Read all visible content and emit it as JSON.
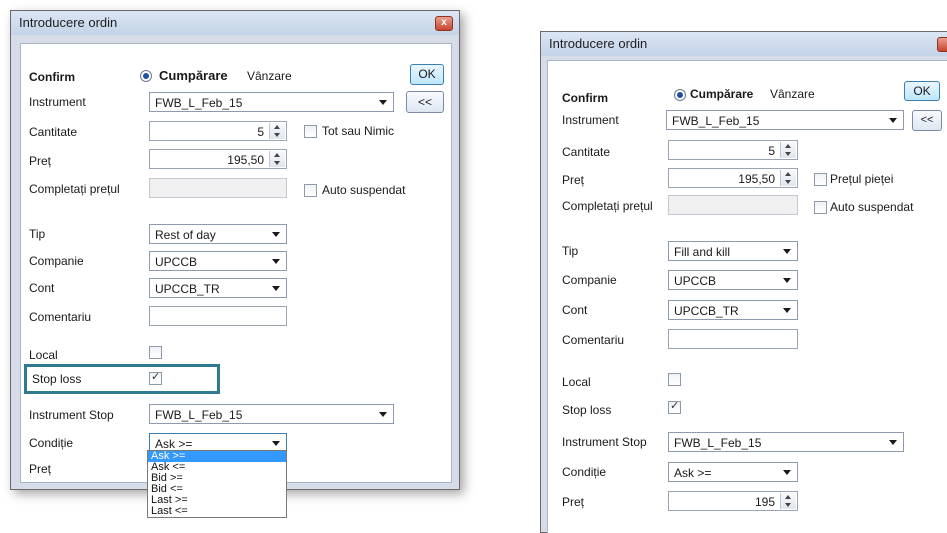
{
  "left": {
    "title": "Introducere ordin",
    "close": "x",
    "confirm_label": "Confirm",
    "buy_label": "Cumpărare",
    "sell_label": "Vânzare",
    "ok_label": "OK",
    "instrument_label": "Instrument",
    "instrument_value": "FWB_L_Feb_15",
    "expand_label": "<<",
    "quantity_label": "Cantitate",
    "quantity_value": "5",
    "all_or_nothing_label": "Tot sau Nimic",
    "price_label": "Preț",
    "price_value": "195,50",
    "fill_price_label": "Completați prețul",
    "auto_suspend_label": "Auto suspendat",
    "type_label": "Tip",
    "type_value": "Rest of day",
    "company_label": "Companie",
    "company_value": "UPCCB",
    "account_label": "Cont",
    "account_value": "UPCCB_TR",
    "comment_label": "Comentariu",
    "local_label": "Local",
    "stoploss_label": "Stop loss",
    "stoploss_checked": true,
    "stop_instrument_label": "Instrument Stop",
    "stop_instrument_value": "FWB_L_Feb_15",
    "condition_label": "Condiție",
    "condition_value": "Ask >=",
    "stop_price_label": "Preț",
    "condition_options": [
      "Ask >=",
      "Ask <=",
      "Bid >=",
      "Bid <=",
      "Last >=",
      "Last <="
    ]
  },
  "right": {
    "title": "Introducere ordin",
    "confirm_label": "Confirm",
    "buy_label": "Cumpărare",
    "sell_label": "Vânzare",
    "ok_label": "OK",
    "instrument_label": "Instrument",
    "instrument_value": "FWB_L_Feb_15",
    "expand_label": "<<",
    "quantity_label": "Cantitate",
    "quantity_value": "5",
    "price_label": "Preț",
    "price_value": "195,50",
    "market_price_label": "Prețul pieței",
    "fill_price_label": "Completați prețul",
    "auto_suspend_label": "Auto suspendat",
    "type_label": "Tip",
    "type_value": "Fill and kill",
    "company_label": "Companie",
    "company_value": "UPCCB",
    "account_label": "Cont",
    "account_value": "UPCCB_TR",
    "comment_label": "Comentariu",
    "local_label": "Local",
    "stoploss_label": "Stop loss",
    "stoploss_checked": true,
    "stop_instrument_label": "Instrument Stop",
    "stop_instrument_value": "FWB_L_Feb_15",
    "condition_label": "Condiție",
    "condition_value": "Ask >=",
    "stop_price_label": "Preț",
    "stop_price_value": "195"
  },
  "colors": {
    "highlight": "#2f7a8f",
    "selected": "#3399ff",
    "title_bg": "#c4d3e8"
  }
}
